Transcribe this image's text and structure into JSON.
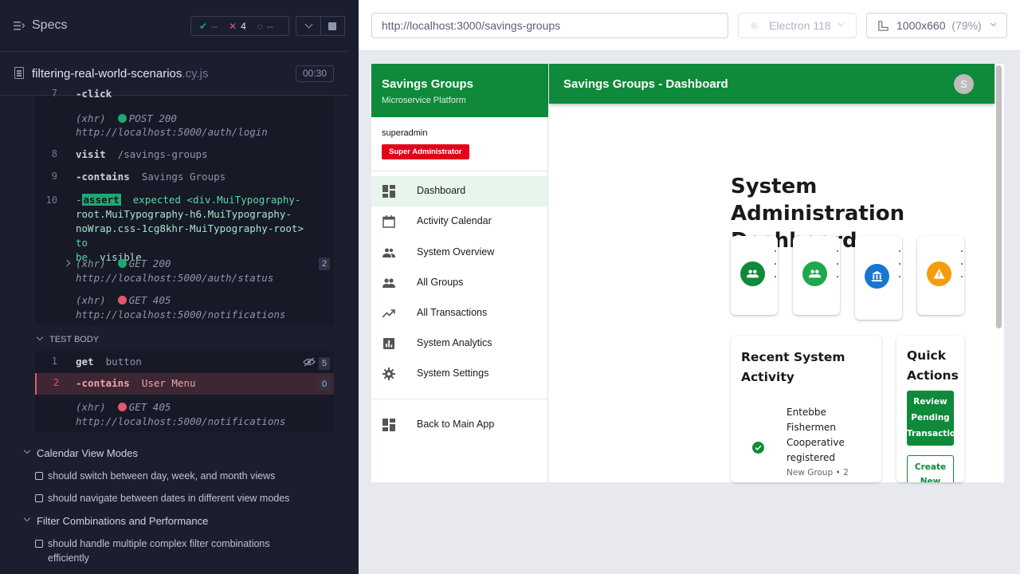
{
  "reporter": {
    "specs_label": "Specs",
    "stats": {
      "passed": "--",
      "failed": "4",
      "pending": "--"
    },
    "spec_file": {
      "name": "filtering-real-world-scenarios",
      "ext": ".cy.js",
      "duration": "00:30"
    },
    "commands_top": [
      {
        "num": "7",
        "name": "-click",
        "arg": ""
      },
      {
        "num": "",
        "xhr": "(xhr)",
        "method": "POST 200",
        "url": "http://localhost:5000/auth/login",
        "status": "green"
      },
      {
        "num": "8",
        "name": "visit",
        "arg": "/savings-groups"
      },
      {
        "num": "9",
        "name": "-contains",
        "arg": "Savings Groups"
      }
    ],
    "assert": {
      "num": "10",
      "prefix": "-",
      "tag": "assert",
      "line1": "expected <div.MuiTypography-",
      "line2": "root.MuiTypography-h6.MuiTypography-",
      "line3_code": "noWrap.css-1cg8khr-MuiTypography-root>",
      "line3_to": "to",
      "line4_be": "be",
      "line4_visible": "visible"
    },
    "xhr_status": {
      "xhr": "(xhr)",
      "method": "GET 200",
      "url": "http://localhost:5000/auth/status",
      "count": "2"
    },
    "xhr_notif1": {
      "xhr": "(xhr)",
      "method": "GET 405",
      "url": "http://localhost:5000/notifications"
    },
    "test_body_label": "TEST BODY",
    "body_commands": [
      {
        "num": "1",
        "name": "get",
        "arg": "button",
        "count": "5"
      },
      {
        "num": "2",
        "name": "-contains",
        "arg": "User Menu",
        "count": "0"
      }
    ],
    "xhr_notif2": {
      "xhr": "(xhr)",
      "method": "GET 405",
      "url": "http://localhost:5000/notifications"
    },
    "suites": [
      {
        "title": "Calendar View Modes",
        "tests": [
          "should switch between day, week, and month views",
          "should navigate between dates in different view modes"
        ]
      },
      {
        "title": "Filter Combinations and Performance",
        "tests": [
          "should handle multiple complex filter combinations",
          "efficiently"
        ]
      }
    ]
  },
  "aut_bar": {
    "url": "http://localhost:3000/savings-groups",
    "browser": "Electron 118",
    "viewport": "1000x660",
    "zoom": "(79%)"
  },
  "app": {
    "sidebar": {
      "title": "Savings Groups",
      "subtitle": "Microservice Platform",
      "user": "superadmin",
      "role": "Super Administrator",
      "items": [
        {
          "label": "Dashboard",
          "icon": "dashboard-icon",
          "active": true
        },
        {
          "label": "Activity Calendar",
          "icon": "calendar-icon"
        },
        {
          "label": "System Overview",
          "icon": "people-icon"
        },
        {
          "label": "All Groups",
          "icon": "groups-icon"
        },
        {
          "label": "All Transactions",
          "icon": "trending-up-icon"
        },
        {
          "label": "System Analytics",
          "icon": "analytics-icon"
        },
        {
          "label": "System Settings",
          "icon": "gear-icon"
        }
      ],
      "back_label": "Back to Main App"
    },
    "topbar": {
      "title": "Savings Groups - Dashboard",
      "avatar": "S"
    },
    "dashboard_title": "System Administration Dashboard",
    "stat_cards": [
      {
        "icon": "groups-icon",
        "color": "#0e8a3a"
      },
      {
        "icon": "groups-icon",
        "color": "#1ea84b"
      },
      {
        "icon": "bank-icon",
        "color": "#1976d2"
      },
      {
        "icon": "warning-icon",
        "color": "#f59c0b"
      }
    ],
    "recent_activity": {
      "title": "Recent System Activity",
      "item_text": "Entebbe Fishermen Cooperative registered",
      "item_meta": "New Group • 2"
    },
    "quick_actions": {
      "title": "Quick Actions",
      "primary": "Review Pending Transactions",
      "secondary": "Create New"
    }
  },
  "colors": {
    "accent_green": "#0e8a3a",
    "role_red": "#e3001b",
    "reporter_bg": "#1b1e2e",
    "fail_red": "#e45770",
    "pass_green": "#1fa971"
  }
}
